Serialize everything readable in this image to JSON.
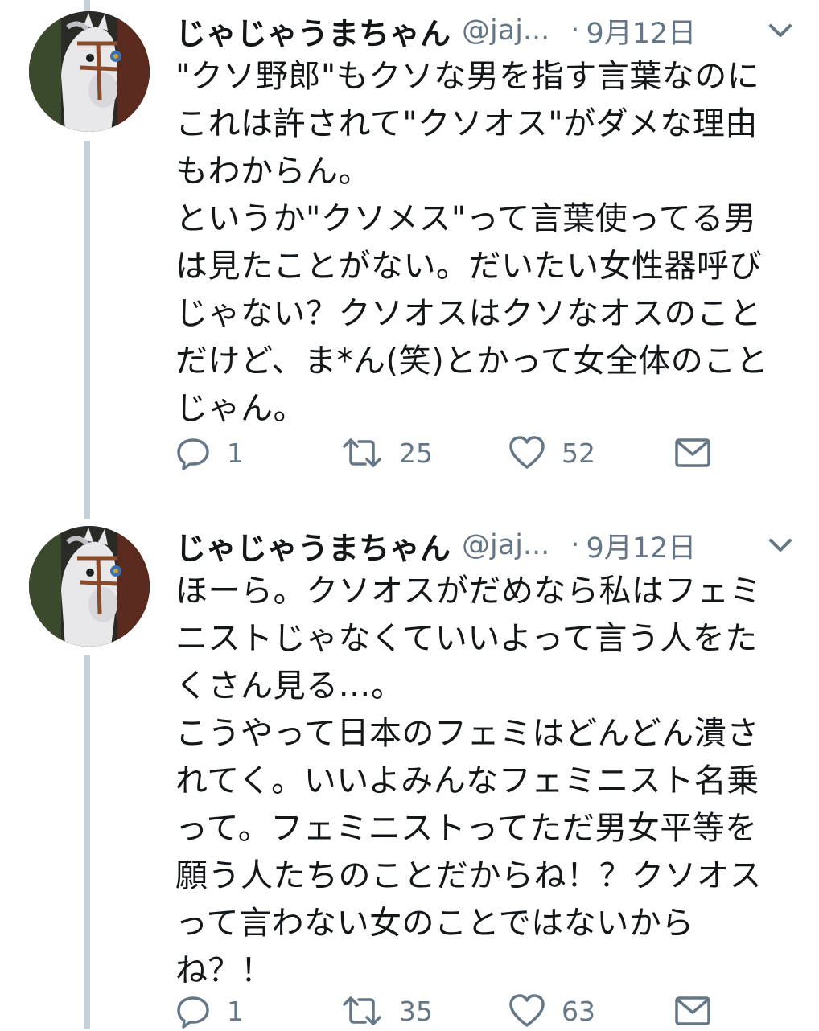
{
  "tweets": [
    {
      "author_name": "じゃじゃうまちゃん",
      "handle": "@jaj...",
      "date": "9月12日",
      "text": "\"クソ野郎\"もクソな男を指す言葉なのに\nこれは許されて\"クソオス\"がダメな理由\nもわからん。\nというか\"クソメス\"って言葉使ってる男\nは見たことがない。だいたい女性器呼び\nじゃない？クソオスはクソなオスのこと\nだけど、ま*ん(笑)とかって女全体のこと\nじゃん。",
      "reply_count": "1",
      "retweet_count": "25",
      "like_count": "52"
    },
    {
      "author_name": "じゃじゃうまちゃん",
      "handle": "@jaj...",
      "date": "9月12日",
      "text": "ほーら。クソオスがだめなら私はフェミ\nニストじゃなくていいよって言う人をた\nくさん見る…。\nこうやって日本のフェミはどんどん潰さ\nれてく。いいよみんなフェミニスト名乗\nって。フェミニストってただ男女平等を\n願う人たちのことだからね！？クソオス\nって言わない女のことではないから\nね？！",
      "reply_count": "1",
      "retweet_count": "35",
      "like_count": "63"
    }
  ],
  "icons": {
    "reply": "reply-icon",
    "retweet": "retweet-icon",
    "like": "heart-icon",
    "message": "envelope-icon",
    "menu": "chevron-down-icon"
  },
  "colors": {
    "text": "#14171a",
    "secondary": "#657786",
    "thread_line": "#c7d0d8"
  }
}
